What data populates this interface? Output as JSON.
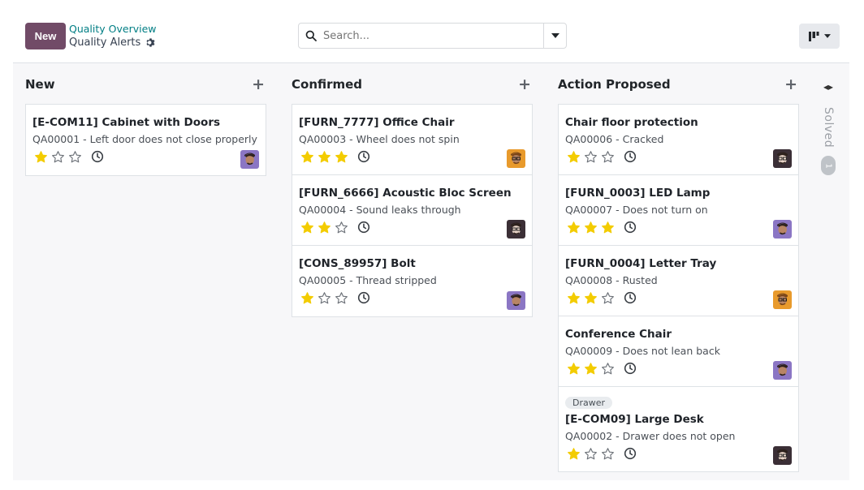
{
  "control_panel": {
    "new_label": "New",
    "breadcrumb_parent": "Quality Overview",
    "breadcrumb_current": "Quality Alerts",
    "search_placeholder": "Search..."
  },
  "columns": [
    {
      "title": "New",
      "cards": [
        {
          "title": "[E-COM11] Cabinet with Doors",
          "sub": "QA00001 - Left door does not close properly",
          "stars": 1,
          "avatar": "purple"
        }
      ]
    },
    {
      "title": "Confirmed",
      "cards": [
        {
          "title": "[FURN_7777] Office Chair",
          "sub": "QA00003 - Wheel does not spin",
          "stars": 3,
          "avatar": "orange"
        },
        {
          "title": "[FURN_6666] Acoustic Bloc Screen",
          "sub": "QA00004 - Sound leaks through",
          "stars": 2,
          "avatar": "dark"
        },
        {
          "title": "[CONS_89957] Bolt",
          "sub": "QA00005 - Thread stripped",
          "stars": 1,
          "avatar": "purple"
        }
      ]
    },
    {
      "title": "Action Proposed",
      "cards": [
        {
          "title": "Chair floor protection",
          "sub": "QA00006 - Cracked",
          "stars": 1,
          "avatar": "dark"
        },
        {
          "title": "[FURN_0003] LED Lamp",
          "sub": "QA00007 - Does not turn on",
          "stars": 3,
          "avatar": "purple"
        },
        {
          "title": "[FURN_0004] Letter Tray",
          "sub": "QA00008 - Rusted",
          "stars": 2,
          "avatar": "orange"
        },
        {
          "title": "Conference Chair",
          "sub": "QA00009 - Does not lean back",
          "stars": 2,
          "avatar": "purple"
        },
        {
          "title": "[E-COM09] Large Desk",
          "sub": "QA00002 - Drawer does not open",
          "stars": 1,
          "avatar": "dark",
          "tag": "Drawer"
        }
      ]
    }
  ],
  "folded_column": {
    "title": "Solved",
    "count": "1"
  },
  "colors": {
    "primary": "#714b67",
    "link": "#017e84",
    "star": "#f3cc00"
  }
}
